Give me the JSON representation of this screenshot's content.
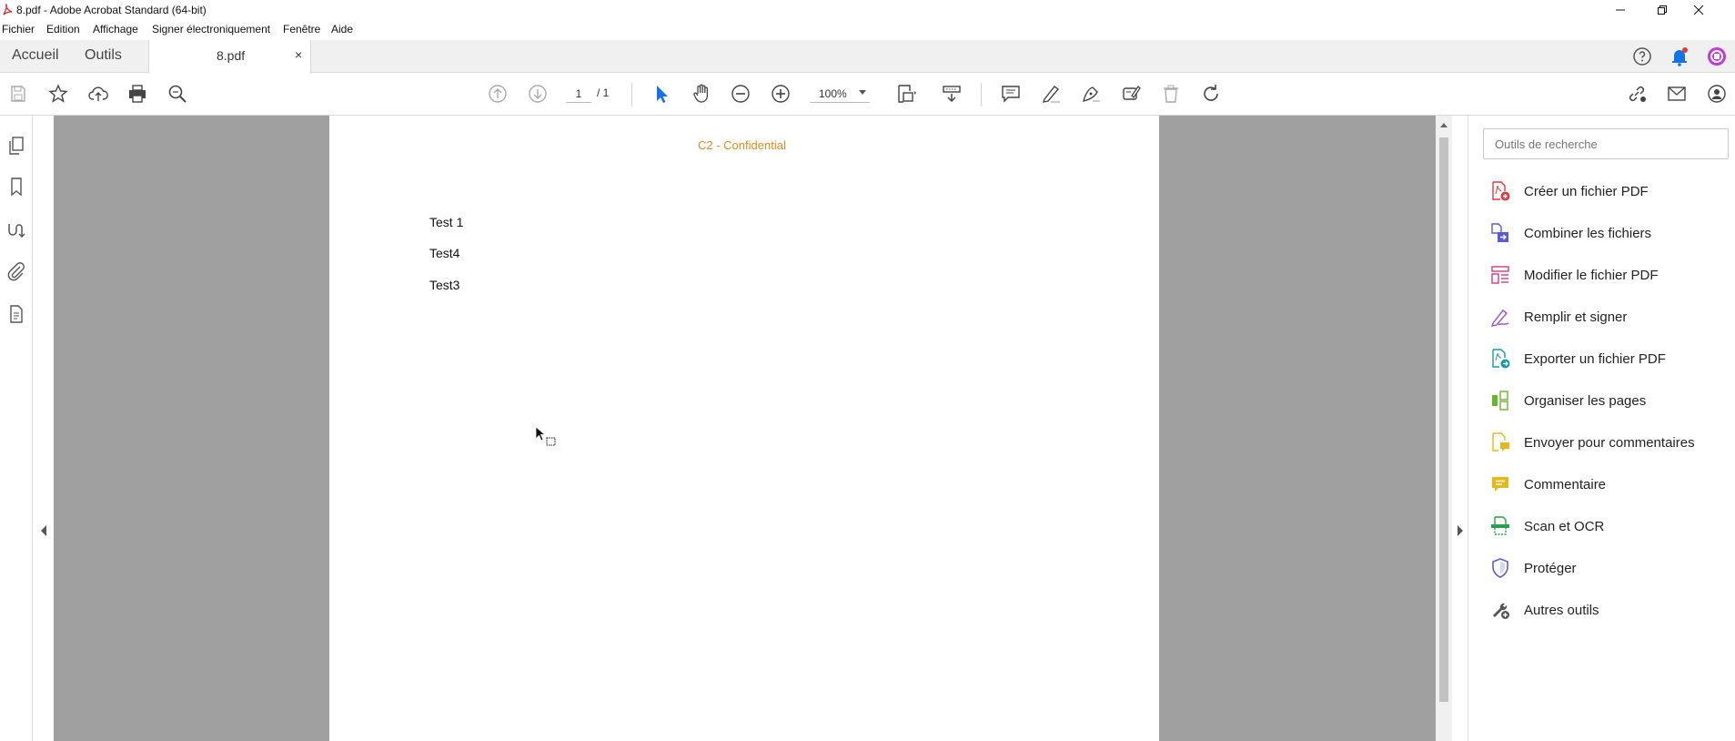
{
  "window": {
    "title": "8.pdf - Adobe Acrobat Standard  (64-bit)",
    "icons": [
      "acrobat-app-icon",
      "minimize-icon",
      "restore-icon",
      "close-icon"
    ]
  },
  "menu": [
    "Fichier",
    "Edition",
    "Affichage",
    "Signer électroniquement",
    "Fenêtre",
    "Aide"
  ],
  "tabs": {
    "home": "Accueil",
    "tools": "Outils",
    "document": "8.pdf",
    "close": "×"
  },
  "toolbar": {
    "page_current": "1",
    "page_total": "/ 1",
    "zoom": "100%",
    "icons": [
      "save-icon",
      "star-icon",
      "cloud-upload-icon",
      "print-icon",
      "search-icon",
      "prev-page-icon",
      "next-page-icon",
      "select-cursor-icon",
      "hand-icon",
      "zoom-out-icon",
      "zoom-in-icon",
      "page-fit-icon",
      "scroll-mode-icon",
      "comment-icon",
      "highlight-icon",
      "sign-icon",
      "stamp-icon",
      "delete-icon",
      "rotate-icon",
      "share-link-icon",
      "email-icon",
      "account-icon"
    ]
  },
  "document": {
    "header": "C2 - Confidential",
    "lines": [
      "Test 1",
      "Test4",
      "Test3"
    ]
  },
  "tools_panel": {
    "search_placeholder": "Outils de recherche",
    "tools": [
      {
        "label": "Créer un fichier PDF",
        "icon": "create-pdf-icon",
        "color": "#e0393e"
      },
      {
        "label": "Combiner les fichiers",
        "icon": "combine-files-icon",
        "color": "#5b5bd6"
      },
      {
        "label": "Modifier le fichier PDF",
        "icon": "edit-pdf-icon",
        "color": "#d4387a"
      },
      {
        "label": "Remplir et signer",
        "icon": "fill-sign-icon",
        "color": "#9b4fd6"
      },
      {
        "label": "Exporter un fichier PDF",
        "icon": "export-pdf-icon",
        "color": "#1a9aa0"
      },
      {
        "label": "Organiser les pages",
        "icon": "organize-pages-icon",
        "color": "#6ab42d"
      },
      {
        "label": "Envoyer pour commentaires",
        "icon": "send-comments-icon",
        "color": "#e5b81e"
      },
      {
        "label": "Commentaire",
        "icon": "comment-tool-icon",
        "color": "#e5b81e"
      },
      {
        "label": "Scan et OCR",
        "icon": "scan-ocr-icon",
        "color": "#2aa04a"
      },
      {
        "label": "Protéger",
        "icon": "protect-icon",
        "color": "#5b5bd6"
      },
      {
        "label": "Autres outils",
        "icon": "more-tools-icon",
        "color": "#555555"
      }
    ]
  },
  "colors": {
    "header_text": "#e08a1e",
    "viewer_bg": "#a0a0a0",
    "accent_blue": "#1473e6",
    "notification": "#e0393e"
  }
}
